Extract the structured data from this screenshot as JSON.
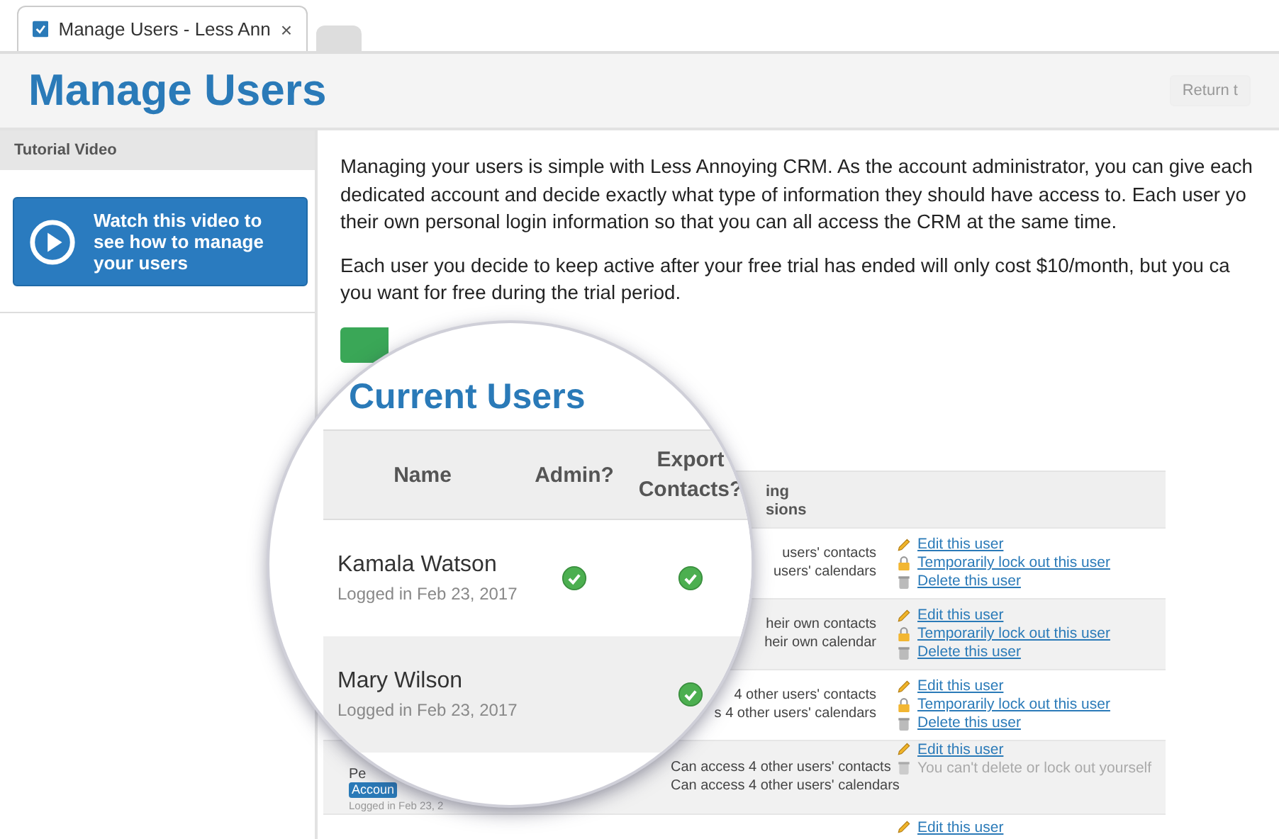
{
  "browser_tabs": [
    {
      "title": "Manage Users - Less Ann",
      "close": "×",
      "selected": true
    },
    {
      "selected": false
    }
  ],
  "page": {
    "title": "Manage Users",
    "return_button": "Return t"
  },
  "sidebar": {
    "heading": "Tutorial Video",
    "video_button": "Watch this video to see how to manage your users"
  },
  "intro": [
    {
      "lines": [
        "Managing your users is simple with Less Annoying CRM. As the account administrator, you can give each",
        "dedicated account and decide exactly what type of information they should have access to. Each user yo",
        "their own personal login information so that you can all access the CRM at the same time."
      ]
    },
    {
      "lines": [
        "Each user you decide to keep active after your free trial has ended will only cost $10/month, but you ca",
        "you want for free during the trial period."
      ]
    }
  ],
  "users_table": {
    "column_2": [
      "ing",
      "sions"
    ],
    "rows": [
      {
        "permissions": [
          "users' contacts",
          "users' calendars"
        ],
        "actions": [
          {
            "kind": "edit",
            "label": "Edit this user"
          },
          {
            "kind": "lock",
            "label": "Temporarily lock out this user"
          },
          {
            "kind": "delete",
            "label": "Delete this user"
          }
        ]
      },
      {
        "permissions": [
          "heir own contacts",
          "heir own calendar"
        ],
        "actions": [
          {
            "kind": "edit",
            "label": "Edit this user"
          },
          {
            "kind": "lock",
            "label": "Temporarily lock out this user"
          },
          {
            "kind": "delete",
            "label": "Delete this user"
          }
        ]
      },
      {
        "permissions": [
          "4 other users' contacts",
          "s 4 other users' calendars"
        ],
        "actions": [
          {
            "kind": "edit",
            "label": "Edit this user"
          },
          {
            "kind": "lock",
            "label": "Temporarily lock out this user"
          },
          {
            "kind": "delete",
            "label": "Delete this user"
          }
        ]
      },
      {
        "name": "Pe",
        "badge": "Accoun",
        "login": "Logged in Feb 23, 2",
        "permissions": [
          "Can access 4 other users' contacts",
          "Can access 4 other users' calendars"
        ],
        "actions": [
          {
            "kind": "edit",
            "label": "Edit this user"
          },
          {
            "kind": "notice",
            "label": "You can't delete or lock out yourself"
          }
        ]
      },
      {
        "permissions": [],
        "actions": [
          {
            "kind": "edit",
            "label": "Edit this user"
          }
        ]
      }
    ]
  },
  "magnifier": {
    "heading": "Current Users",
    "columns": [
      "Name",
      "Admin?",
      "Export Contacts?"
    ],
    "rows": [
      {
        "name": "Kamala Watson",
        "login": "Logged in Feb 23, 2017",
        "admin": true,
        "export_contacts": true
      },
      {
        "name": "Mary Wilson",
        "login": "Logged in Feb 23, 2017",
        "admin": false,
        "export_contacts": true
      }
    ]
  }
}
